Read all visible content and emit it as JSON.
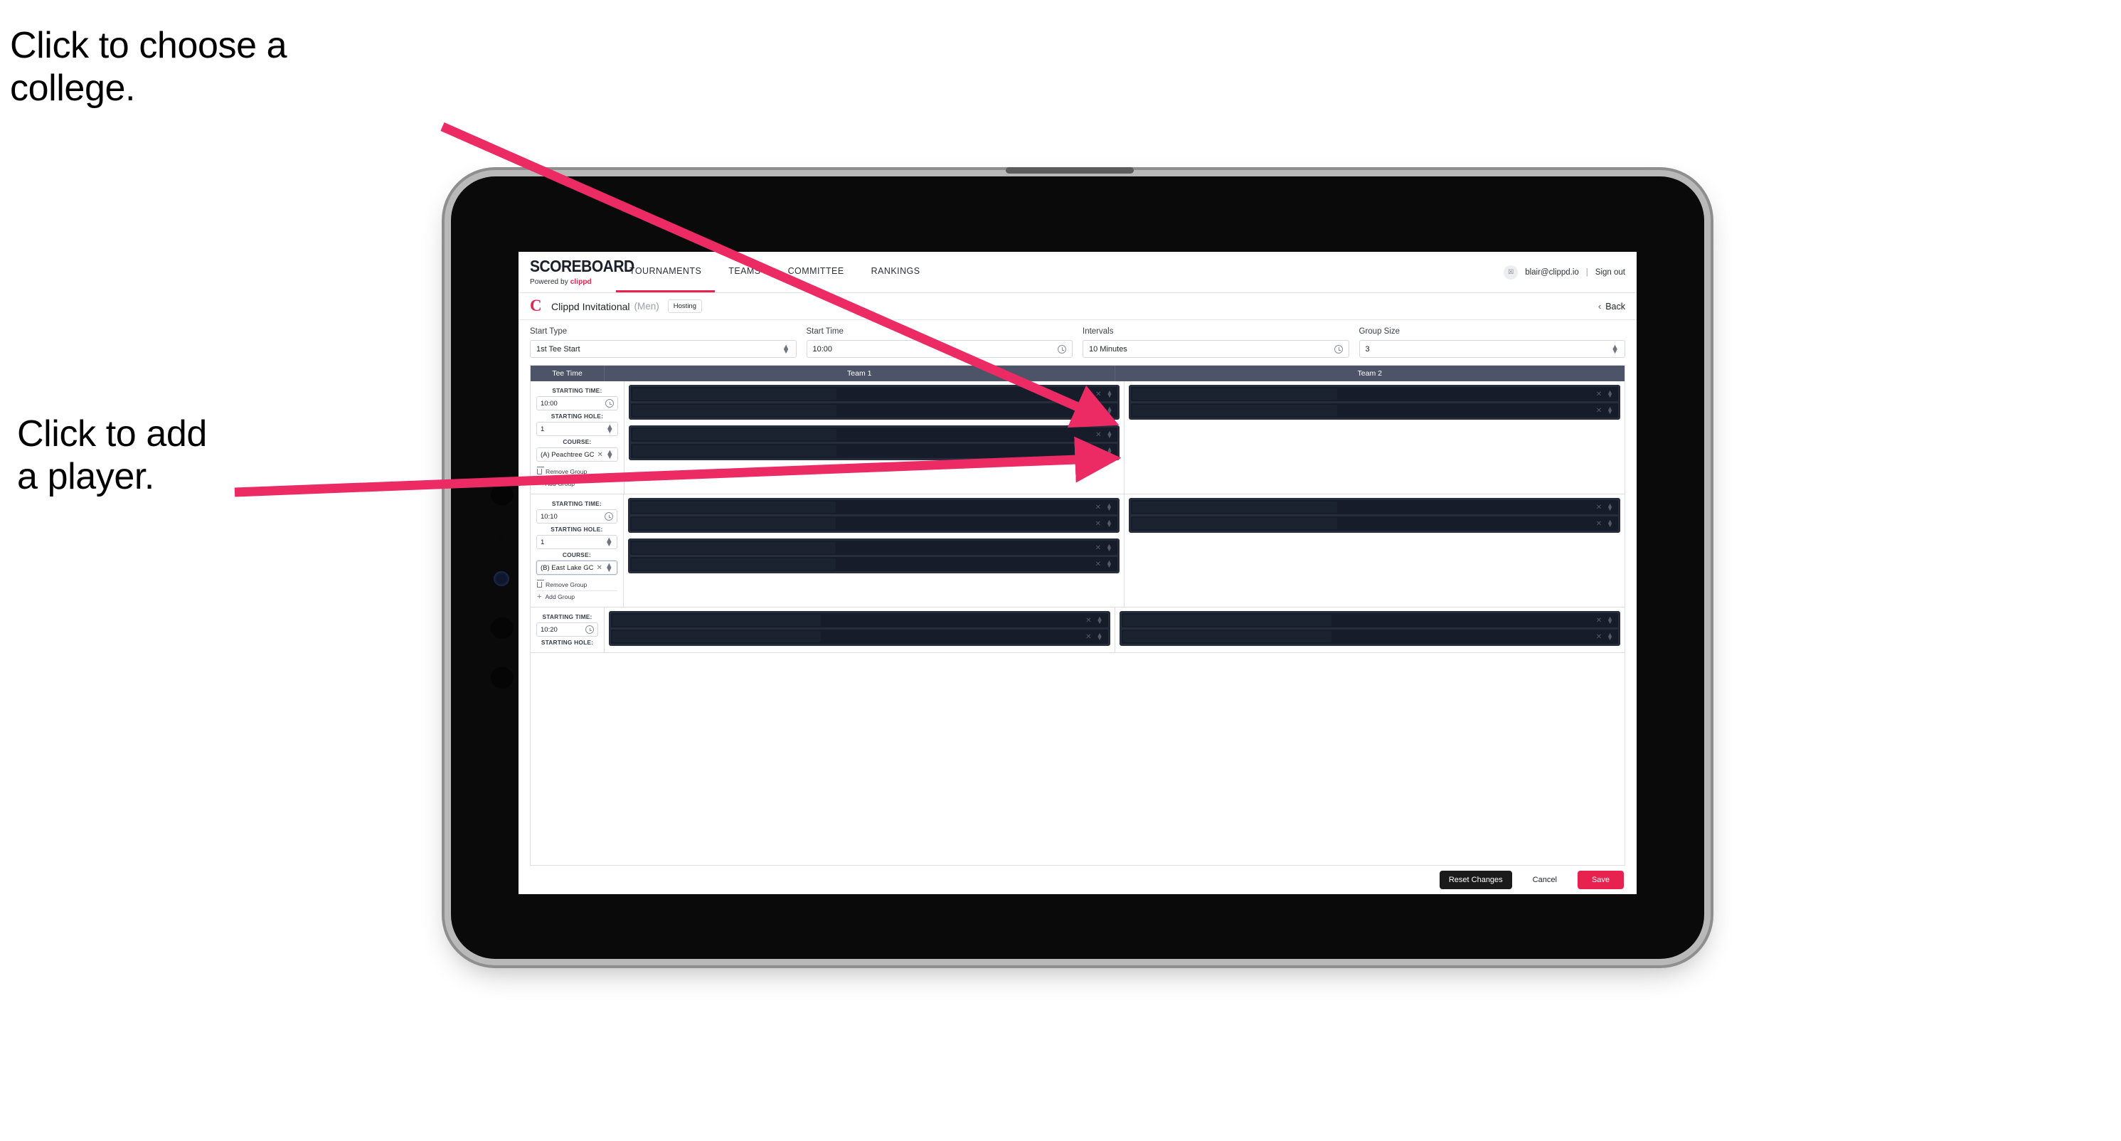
{
  "annotations": {
    "college": "Click to choose a\ncollege.",
    "player": "Click to add\na player."
  },
  "topnav": {
    "brand_word": "SCOREBOARD",
    "brand_powered_prefix": "Powered by ",
    "brand_powered_name": "clippd",
    "tabs": [
      {
        "label": "TOURNAMENTS",
        "active": true
      },
      {
        "label": "TEAMS",
        "active": false
      },
      {
        "label": "COMMITTEE",
        "active": false
      },
      {
        "label": "RANKINGS",
        "active": false
      }
    ],
    "account_email": "blair@clippd.io",
    "separator": "|",
    "signout_label": "Sign out",
    "avatar_glyph": "☒"
  },
  "tournament": {
    "logo_letter": "C",
    "name": "Clippd Invitational",
    "gender": "(Men)",
    "badge": "Hosting",
    "back_label": "Back",
    "back_chevron": "‹"
  },
  "settings": {
    "fields": [
      {
        "label": "Start Type",
        "value": "1st Tee Start",
        "icon": "stepper-icon"
      },
      {
        "label": "Start Time",
        "value": "10:00",
        "icon": "clock-icon"
      },
      {
        "label": "Intervals",
        "value": "10 Minutes",
        "icon": "clock-icon"
      },
      {
        "label": "Group Size",
        "value": "3",
        "icon": "stepper-icon"
      }
    ]
  },
  "table": {
    "headers": {
      "tee_time": "Tee Time",
      "team1": "Team 1",
      "team2": "Team 2"
    },
    "labels": {
      "starting_time": "STARTING TIME:",
      "starting_hole": "STARTING HOLE:",
      "course": "COURSE:",
      "remove_group": "Remove Group",
      "add_group": "Add Group"
    },
    "rows": [
      {
        "starting_time": "10:00",
        "starting_hole": "1",
        "course": "(A) Peachtree GC",
        "course_focused": false,
        "team1_groups": [
          2,
          2
        ],
        "team2_groups": [
          2
        ]
      },
      {
        "starting_time": "10:10",
        "starting_hole": "1",
        "course": "(B) East Lake GC",
        "course_focused": true,
        "team1_groups": [
          2,
          2
        ],
        "team2_groups": [
          2
        ]
      },
      {
        "starting_time": "10:20",
        "starting_hole": "",
        "course": "",
        "course_focused": false,
        "team1_groups": [
          2
        ],
        "team2_groups": [
          2
        ]
      }
    ]
  },
  "footer": {
    "reset_label": "Reset Changes",
    "cancel_label": "Cancel",
    "save_label": "Save"
  },
  "colors": {
    "accent": "#e8224f",
    "header_bar": "#4d5468",
    "dark_block": "#252c3b",
    "dark_row": "#161c29"
  }
}
